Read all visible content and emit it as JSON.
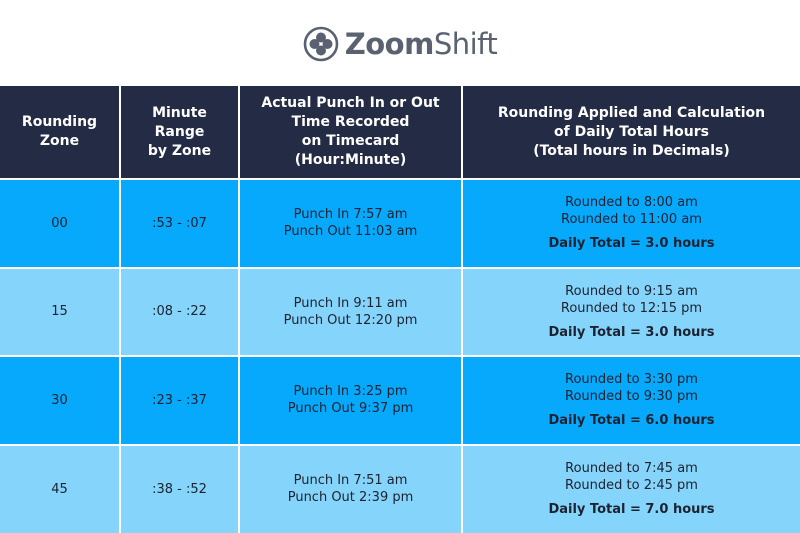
{
  "logo": {
    "icon": "zoomshift-flower-icon",
    "text_bold": "Zoom",
    "text_light": "Shift",
    "color": "#5a6272"
  },
  "colors": {
    "header_bg": "#232b45",
    "row_dark": "#06a9fc",
    "row_light": "#84d4fc"
  },
  "table": {
    "headers": [
      [
        "Rounding",
        "Zone"
      ],
      [
        "Minute",
        "Range",
        "by Zone"
      ],
      [
        "Actual Punch In or Out",
        "Time Recorded",
        "on Timecard",
        "(Hour:Minute)"
      ],
      [
        "Rounding Applied and Calculation",
        "of Daily Total Hours",
        "(Total hours in Decimals)"
      ]
    ],
    "rows": [
      {
        "zone": "00",
        "range": ":53 - :07",
        "punch_in": "Punch In 7:57 am",
        "punch_out": "Punch Out 11:03 am",
        "rounded_in": "Rounded to 8:00 am",
        "rounded_out": "Rounded to 11:00 am",
        "total": "Daily Total = 3.0 hours"
      },
      {
        "zone": "15",
        "range": ":08 - :22",
        "punch_in": "Punch In 9:11 am",
        "punch_out": "Punch Out 12:20 pm",
        "rounded_in": "Rounded to 9:15 am",
        "rounded_out": "Rounded to 12:15 pm",
        "total": "Daily Total = 3.0 hours"
      },
      {
        "zone": "30",
        "range": ":23 - :37",
        "punch_in": "Punch In 3:25 pm",
        "punch_out": "Punch Out 9:37 pm",
        "rounded_in": "Rounded to 3:30 pm",
        "rounded_out": "Rounded to 9:30 pm",
        "total": "Daily Total = 6.0 hours"
      },
      {
        "zone": "45",
        "range": ":38 - :52",
        "punch_in": "Punch In 7:51 am",
        "punch_out": "Punch Out 2:39 pm",
        "rounded_in": "Rounded to 7:45 am",
        "rounded_out": "Rounded to 2:45 pm",
        "total": "Daily Total = 7.0 hours"
      }
    ]
  }
}
